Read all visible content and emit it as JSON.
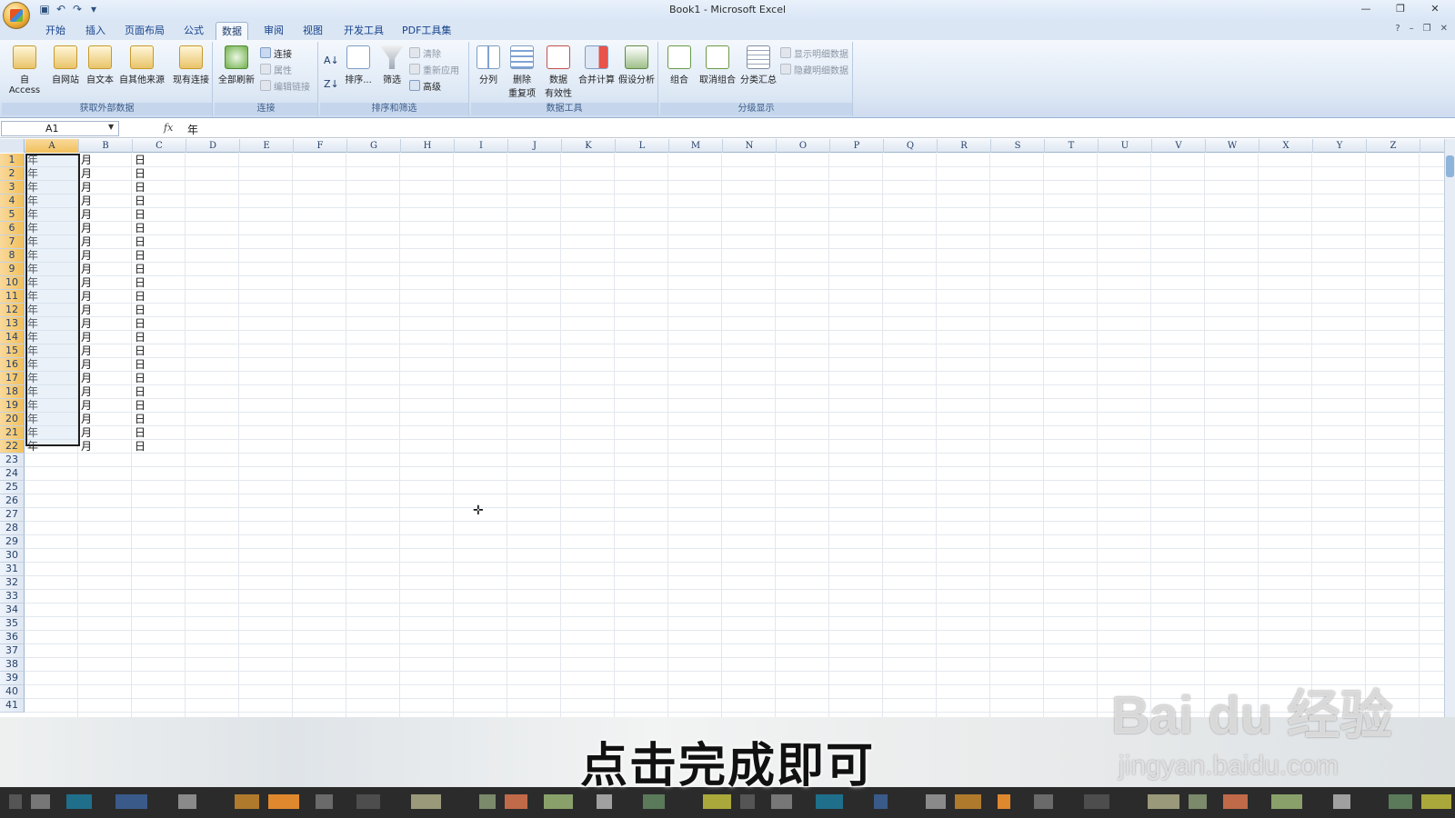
{
  "titlebar": {
    "title": "Book1 - Microsoft Excel",
    "qat_icons": [
      "save-icon",
      "undo-icon",
      "redo-icon",
      "customize-icon"
    ]
  },
  "tabs": [
    "开始",
    "插入",
    "页面布局",
    "公式",
    "数据",
    "审阅",
    "视图",
    "开发工具",
    "PDF工具集"
  ],
  "active_tab": "数据",
  "ribbon": {
    "get_external": {
      "label": "获取外部数据",
      "buttons": [
        "自 Access",
        "自网站",
        "自文本",
        "自其他来源",
        "现有连接"
      ]
    },
    "connections": {
      "label": "连接",
      "refresh_all": "全部刷新",
      "connections": "连接",
      "properties": "属性",
      "edit_links": "编辑链接"
    },
    "sort_filter": {
      "label": "排序和筛选",
      "sort": "排序...",
      "filter": "筛选",
      "clear": "清除",
      "reapply": "重新应用",
      "advanced": "高级"
    },
    "data_tools": {
      "label": "数据工具",
      "text_to_columns": "分列",
      "remove_dup_1": "删除",
      "remove_dup_2": "重复项",
      "validation_1": "数据",
      "validation_2": "有效性",
      "consolidate": "合并计算",
      "what_if": "假设分析"
    },
    "outline": {
      "label": "分级显示",
      "group": "组合",
      "ungroup": "取消组合",
      "subtotal": "分类汇总",
      "show_detail": "显示明细数据",
      "hide_detail": "隐藏明细数据"
    }
  },
  "formula_bar": {
    "name_box": "A1",
    "fx": "fx",
    "content": "年"
  },
  "columns": [
    "A",
    "B",
    "C",
    "D",
    "E",
    "F",
    "G",
    "H",
    "I",
    "J",
    "K",
    "L",
    "M",
    "N",
    "O",
    "P",
    "Q",
    "R",
    "S",
    "T",
    "U",
    "V",
    "W",
    "X",
    "Y",
    "Z"
  ],
  "row_count": 41,
  "data_rows": 22,
  "cell_values": {
    "A": "年",
    "B": "月",
    "C": "日"
  },
  "selected_range": "A1:A22",
  "subtitle": "点击完成即可",
  "watermark": {
    "brand": "Bai du 经验",
    "url": "jingyan.baidu.com"
  }
}
